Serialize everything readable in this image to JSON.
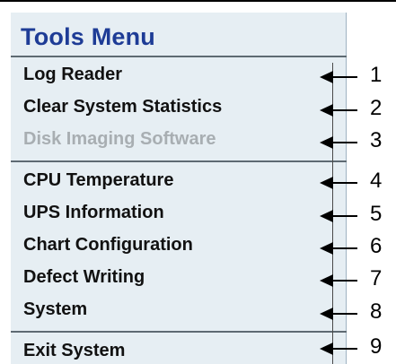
{
  "menu": {
    "title": "Tools Menu",
    "items": [
      {
        "label": "Log Reader",
        "enabled": true
      },
      {
        "label": "Clear System Statistics",
        "enabled": true
      },
      {
        "label": "Disk Imaging Software",
        "enabled": false
      },
      {
        "label": "CPU Temperature",
        "enabled": true
      },
      {
        "label": "UPS Information",
        "enabled": true
      },
      {
        "label": "Chart Configuration",
        "enabled": true
      },
      {
        "label": "Defect Writing",
        "enabled": true
      },
      {
        "label": "System",
        "enabled": true
      },
      {
        "label": "Exit System",
        "enabled": true
      }
    ]
  },
  "annotations": [
    "1",
    "2",
    "3",
    "4",
    "5",
    "6",
    "7",
    "8",
    "9"
  ],
  "colors": {
    "title": "#1e3c96",
    "menu_background": "#e6eef3",
    "disabled_text": "#a8aeb2"
  }
}
